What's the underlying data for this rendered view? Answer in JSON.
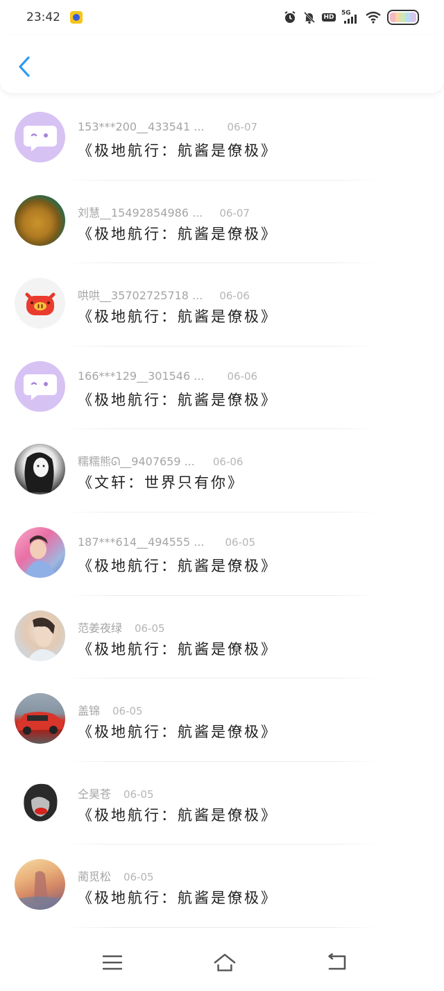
{
  "status_bar": {
    "time": "23:42",
    "icons": [
      "app-icon",
      "alarm-icon",
      "mute-icon",
      "hd-icon",
      "5g-signal-icon",
      "wifi-icon",
      "battery-icon"
    ],
    "hd_label": "HD",
    "network_label": "5G"
  },
  "header": {
    "back_icon": "chevron-left-icon",
    "accent_color": "#2f9bf0"
  },
  "items": [
    {
      "username": "153***200__433541 ...",
      "date": "06-07",
      "title": "《极地航行：航酱是僚极》",
      "avatar": "chat-bubble-avatar"
    },
    {
      "username": "刘慧__15492854986 ...",
      "date": "06-07",
      "title": "《极地航行：航酱是僚极》",
      "avatar": "golden-swirl-avatar"
    },
    {
      "username": "哄哄__35702725718 ...",
      "date": "06-06",
      "title": "《极地航行：航酱是僚极》",
      "avatar": "pig-avatar"
    },
    {
      "username": "166***129__301546 ...",
      "date": "06-06",
      "title": "《极地航行：航酱是僚极》",
      "avatar": "chat-bubble-avatar"
    },
    {
      "username": "糯糯熊ᘏ__9407659 ...",
      "date": "06-06",
      "title": "《文轩：世界只有你》",
      "avatar": "girl-illustration-avatar"
    },
    {
      "username": "187***614__494555 ...",
      "date": "06-05",
      "title": "《极地航行：航酱是僚极》",
      "avatar": "person-pink-avatar"
    },
    {
      "username": "范姜夜绿",
      "date": "06-05",
      "title": "《极地航行：航酱是僚极》",
      "avatar": "boy-portrait-avatar"
    },
    {
      "username": "盖锦",
      "date": "06-05",
      "title": "《极地航行：航酱是僚极》",
      "avatar": "red-car-avatar"
    },
    {
      "username": "仝昊苍",
      "date": "06-05",
      "title": "《极地航行：航酱是僚极》",
      "avatar": "face-red-lips-avatar"
    },
    {
      "username": "蔺觅松",
      "date": "06-05",
      "title": "《极地航行：航酱是僚极》",
      "avatar": "sunset-avatar"
    }
  ],
  "nav_bar": {
    "icons": [
      "menu-icon",
      "home-icon",
      "back-icon"
    ]
  }
}
